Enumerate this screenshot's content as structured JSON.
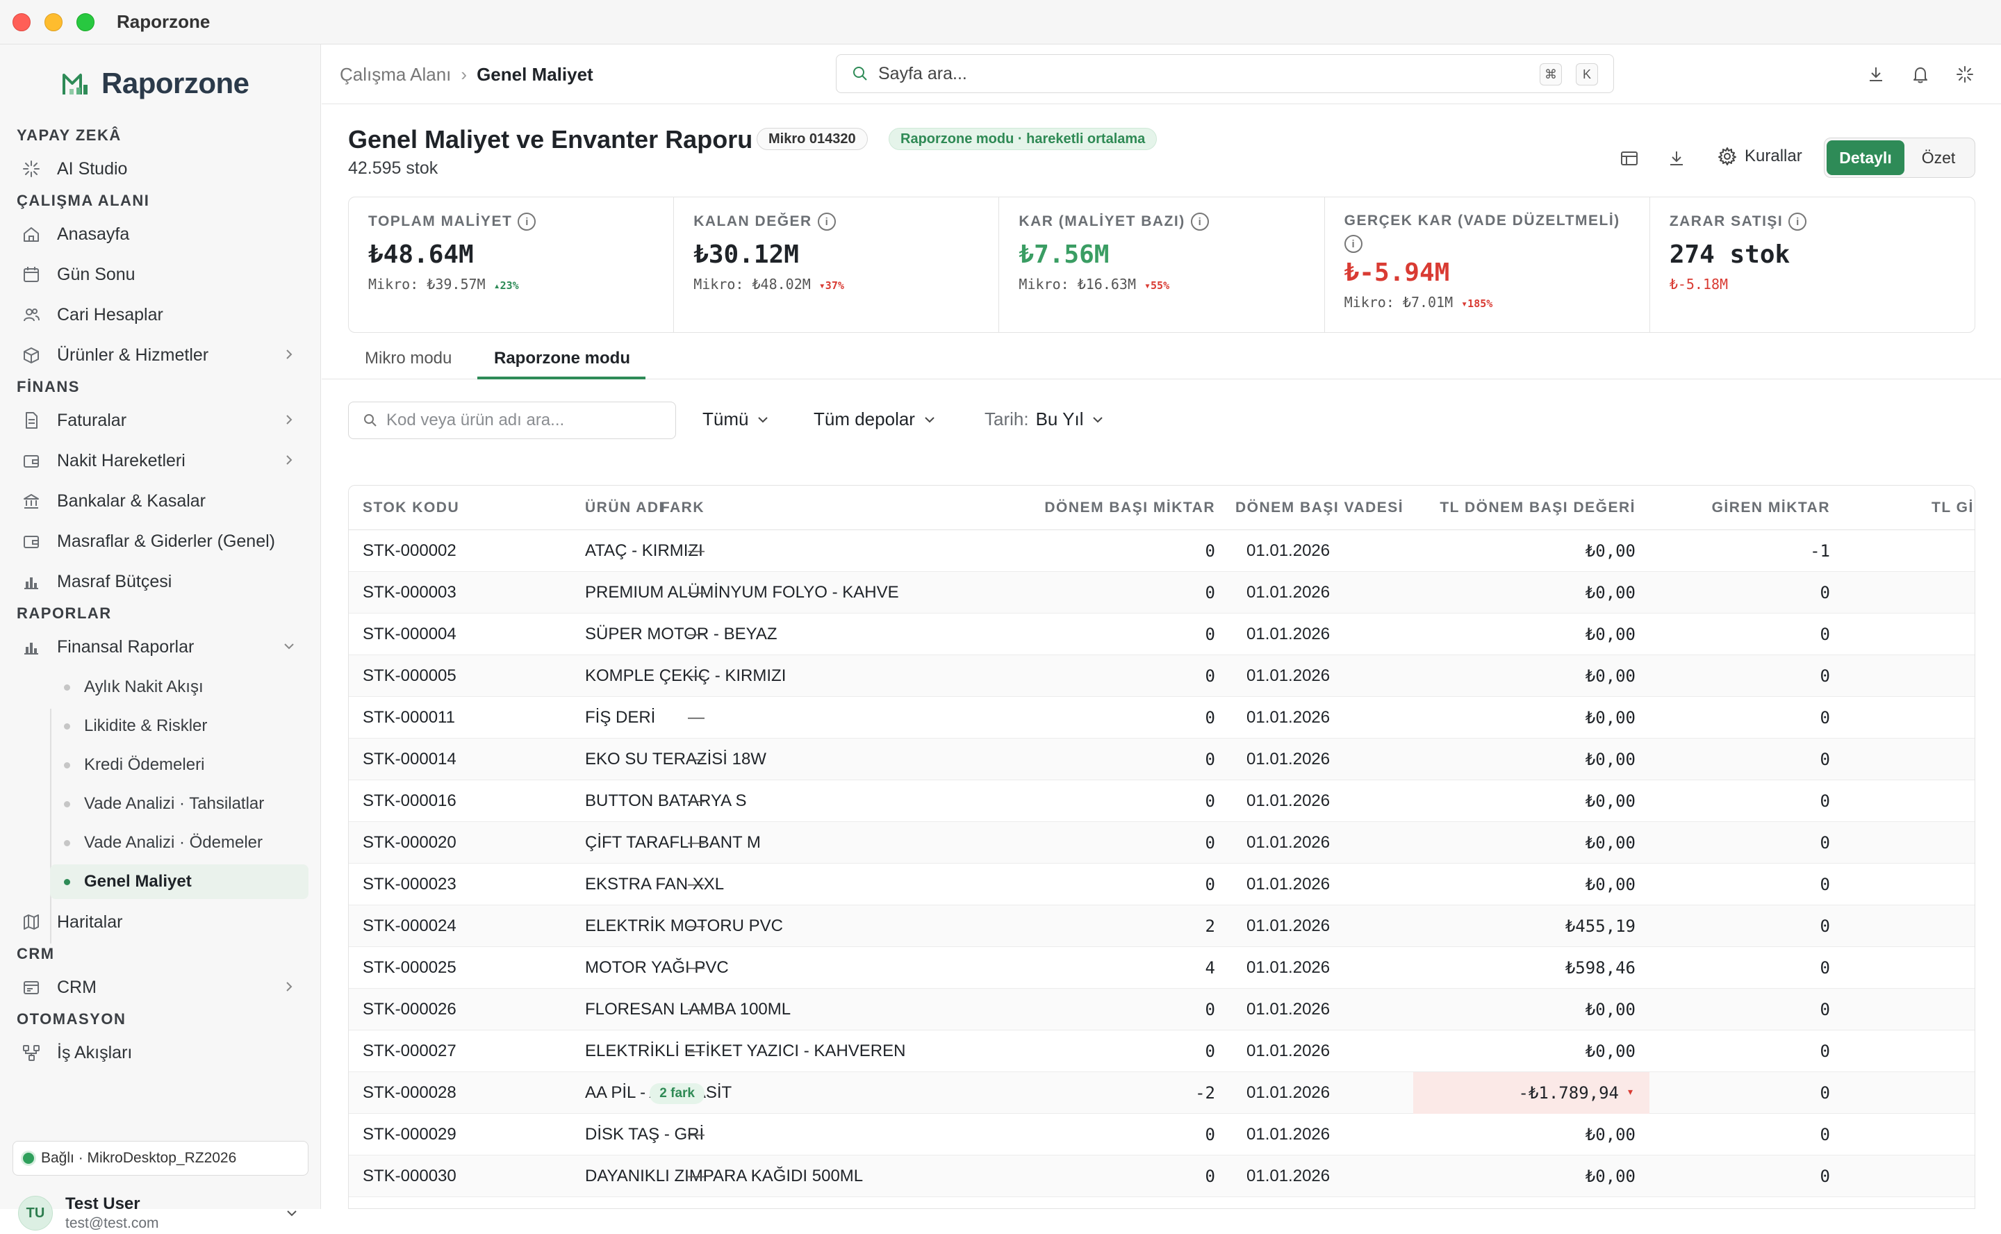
{
  "window": {
    "title": "Raporzone"
  },
  "sidebar": {
    "brand": "Raporzone",
    "sections": {
      "ai": "YAPAY ZEKÂ",
      "workspace": "ÇALIŞMA ALANI",
      "finance": "FİNANS",
      "reports": "RAPORLAR",
      "crm": "CRM",
      "automation": "OTOMASYON"
    },
    "items": {
      "ai_studio": "AI Studio",
      "home": "Anasayfa",
      "day_end": "Gün Sonu",
      "accounts": "Cari Hesaplar",
      "products": "Ürünler & Hizmetler",
      "invoices": "Faturalar",
      "cash_moves": "Nakit Hareketleri",
      "banks": "Bankalar & Kasalar",
      "expenses": "Masraflar & Giderler (Genel)",
      "budget": "Masraf Bütçesi",
      "fin_reports": "Finansal Raporlar",
      "maps": "Haritalar",
      "crm": "CRM",
      "workflows": "İş Akışları"
    },
    "subitems": [
      "Aylık Nakit Akışı",
      "Likidite & Riskler",
      "Kredi Ödemeleri",
      "Vade Analizi · Tahsilatlar",
      "Vade Analizi · Ödemeler",
      "Genel Maliyet"
    ],
    "connection": "Bağlı · MikroDesktop_RZ2026",
    "user": {
      "initials": "TU",
      "name": "Test User",
      "email": "test@test.com"
    }
  },
  "topbar": {
    "breadcrumb": [
      "Çalışma Alanı",
      "Genel Maliyet"
    ],
    "search_placeholder": "Sayfa ara...",
    "kbd": [
      "⌘",
      "K"
    ]
  },
  "page": {
    "title": "Genel Maliyet ve Envanter Raporu",
    "badge_source": "Mikro 014320",
    "badge_mode": "Raporzone modu · hareketli ortalama",
    "subtitle": "42.595 stok",
    "rules_label": "Kurallar",
    "view_detail": "Detaylı",
    "view_summary": "Özet"
  },
  "kpis": [
    {
      "label": "TOPLAM MALİYET",
      "value": "₺48.64M",
      "sub": "Mikro: ₺39.57M",
      "pct": "▴23%",
      "tone": "neutral",
      "pct_dir": "up"
    },
    {
      "label": "KALAN DEĞER",
      "value": "₺30.12M",
      "sub": "Mikro: ₺48.02M",
      "pct": "▾37%",
      "tone": "neutral",
      "pct_dir": "dn"
    },
    {
      "label": "KAR (MALİYET BAZI)",
      "value": "₺7.56M",
      "sub": "Mikro: ₺16.63M",
      "pct": "▾55%",
      "tone": "green",
      "pct_dir": "dn"
    },
    {
      "label": "GERÇEK KAR (VADE DÜZELTMELİ)",
      "value": "₺-5.94M",
      "sub": "Mikro: ₺7.01M",
      "pct": "▾185%",
      "tone": "red",
      "pct_dir": "dn"
    },
    {
      "label": "ZARAR SATIŞI",
      "value": "274 stok",
      "sub": "₺-5.18M",
      "pct": "",
      "tone": "neutral",
      "pct_dir": ""
    }
  ],
  "tabs": [
    "Mikro modu",
    "Raporzone modu"
  ],
  "filters": {
    "search_placeholder": "Kod veya ürün adı ara...",
    "type": "Tümü",
    "warehouse": "Tüm depolar",
    "date_prefix": "Tarih:",
    "date_value": "Bu Yıl"
  },
  "table": {
    "columns": [
      "STOK KODU",
      "ÜRÜN ADI",
      "FARK",
      "DÖNEM BAŞI MİKTAR",
      "DÖNEM BAŞI VADESİ",
      "TL DÖNEM BAŞI DEĞERİ",
      "GİREN MİKTAR",
      "TL Gİ"
    ],
    "rows": [
      {
        "code": "STK-000002",
        "name": "ATAÇ - KIRMIZI",
        "diff": "—",
        "qty": "0",
        "date": "01.01.2026",
        "value": "₺0,00",
        "in_qty": "-1"
      },
      {
        "code": "STK-000003",
        "name": "PREMIUM ALÜMİNYUM FOLYO - KAHVE",
        "diff": "—",
        "qty": "0",
        "date": "01.01.2026",
        "value": "₺0,00",
        "in_qty": "0"
      },
      {
        "code": "STK-000004",
        "name": "SÜPER MOTOR - BEYAZ",
        "diff": "—",
        "qty": "0",
        "date": "01.01.2026",
        "value": "₺0,00",
        "in_qty": "0"
      },
      {
        "code": "STK-000005",
        "name": "KOMPLE ÇEKİÇ - KIRMIZI",
        "diff": "—",
        "qty": "0",
        "date": "01.01.2026",
        "value": "₺0,00",
        "in_qty": "0"
      },
      {
        "code": "STK-000011",
        "name": "FİŞ DERİ",
        "diff": "—",
        "qty": "0",
        "date": "01.01.2026",
        "value": "₺0,00",
        "in_qty": "0"
      },
      {
        "code": "STK-000014",
        "name": "EKO SU TERAZİSİ 18W",
        "diff": "—",
        "qty": "0",
        "date": "01.01.2026",
        "value": "₺0,00",
        "in_qty": "0"
      },
      {
        "code": "STK-000016",
        "name": "BUTTON BATARYA S",
        "diff": "—",
        "qty": "0",
        "date": "01.01.2026",
        "value": "₺0,00",
        "in_qty": "0"
      },
      {
        "code": "STK-000020",
        "name": "ÇİFT TARAFLI BANT M",
        "diff": "—",
        "qty": "0",
        "date": "01.01.2026",
        "value": "₺0,00",
        "in_qty": "0"
      },
      {
        "code": "STK-000023",
        "name": "EKSTRA FAN XXL",
        "diff": "—",
        "qty": "0",
        "date": "01.01.2026",
        "value": "₺0,00",
        "in_qty": "0"
      },
      {
        "code": "STK-000024",
        "name": "ELEKTRİK MOTORU PVC",
        "diff": "—",
        "qty": "2",
        "date": "01.01.2026",
        "value": "₺455,19",
        "in_qty": "0"
      },
      {
        "code": "STK-000025",
        "name": "MOTOR YAĞI PVC",
        "diff": "—",
        "qty": "4",
        "date": "01.01.2026",
        "value": "₺598,46",
        "in_qty": "0"
      },
      {
        "code": "STK-000026",
        "name": "FLORESAN LAMBA 100ML",
        "diff": "—",
        "qty": "0",
        "date": "01.01.2026",
        "value": "₺0,00",
        "in_qty": "0"
      },
      {
        "code": "STK-000027",
        "name": "ELEKTRİKLİ ETİKET YAZICI - KAHVEREN",
        "diff": "—",
        "qty": "0",
        "date": "01.01.2026",
        "value": "₺0,00",
        "in_qty": "0"
      },
      {
        "code": "STK-000028",
        "name": "AA PİL - ANTRASİT",
        "diff": "2 fark",
        "qty": "-2",
        "date": "01.01.2026",
        "value": "-₺1.789,94",
        "value_flag": "▾",
        "in_qty": "0"
      },
      {
        "code": "STK-000029",
        "name": "DİSK TAŞ - GRİ",
        "diff": "—",
        "qty": "0",
        "date": "01.01.2026",
        "value": "₺0,00",
        "in_qty": "0"
      },
      {
        "code": "STK-000030",
        "name": "DAYANIKLI ZIMPARA KAĞIDI 500ML",
        "diff": "—",
        "qty": "0",
        "date": "01.01.2026",
        "value": "₺0,00",
        "in_qty": "0"
      }
    ]
  },
  "colors": {
    "accent": "#2e8b57",
    "negative": "#d93b33",
    "positive": "#3a9d63"
  }
}
